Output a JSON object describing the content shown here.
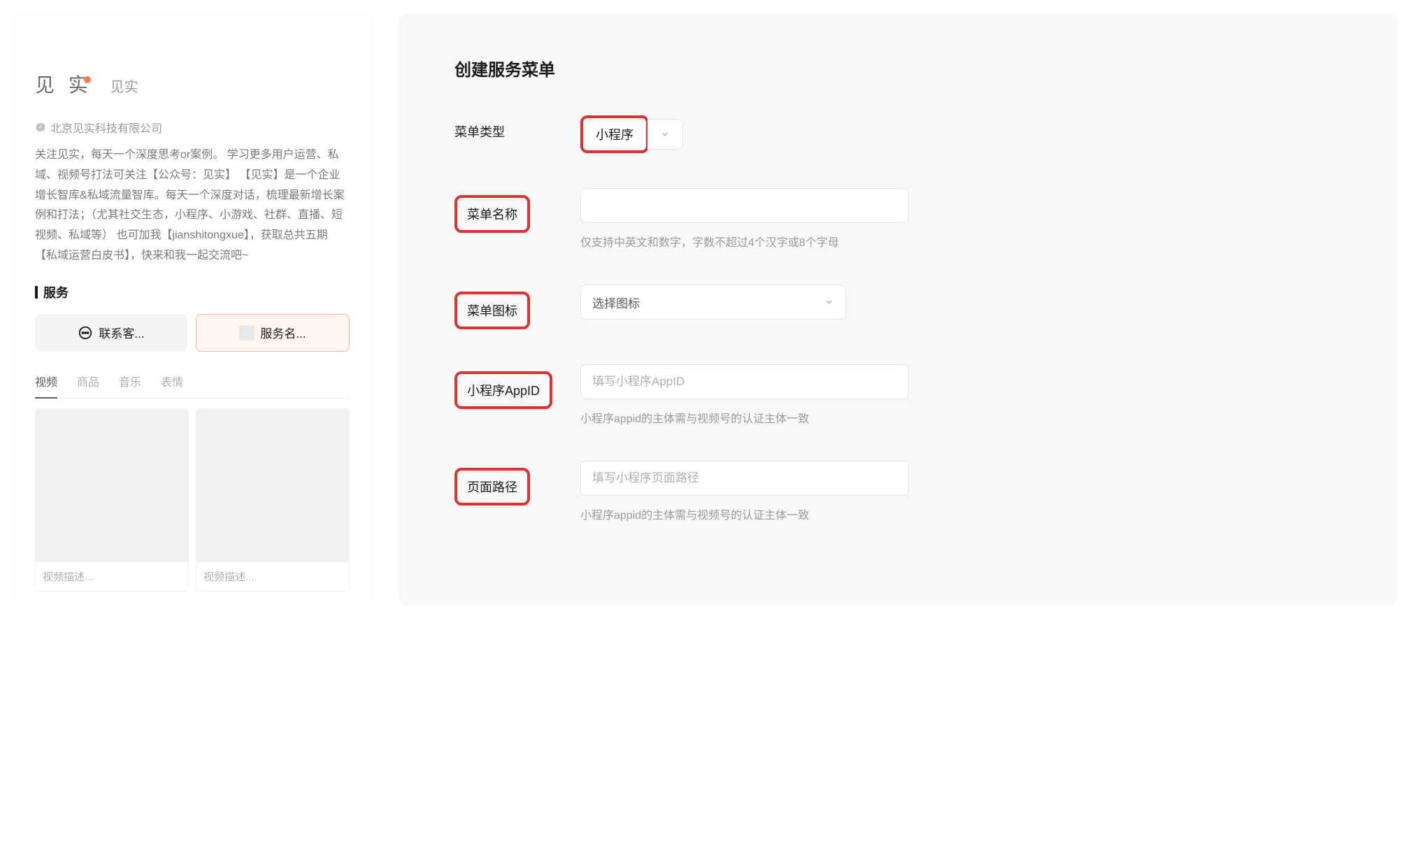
{
  "left": {
    "brandLogo": "见 实",
    "brandName": "见实",
    "company": "北京见实科技有限公司",
    "description": "关注见实，每天一个深度思考or案例。 学习更多用户运营、私域、视频号打法可关注【公众号：见实】 【见实】是一个企业增长智库&私域流量智库。每天一个深度对话，梳理最新增长案例和打法；（尤其社交生态，小程序、小游戏、社群、直播、短视频、私域等） 也可加我【jianshitongxue】，获取总共五期【私域运营白皮书】，快来和我一起交流吧~",
    "serviceTitle": "服务",
    "buttons": {
      "contact": "联系客...",
      "serviceName": "服务名..."
    },
    "tabs": [
      "视频",
      "商品",
      "音乐",
      "表情"
    ],
    "videoDesc": "视频描述..."
  },
  "right": {
    "title": "创建服务菜单",
    "fields": {
      "menuType": {
        "label": "菜单类型",
        "value": "小程序"
      },
      "menuName": {
        "label": "菜单名称",
        "helper": "仅支持中英文和数字，字数不超过4个汉字或8个字母"
      },
      "menuIcon": {
        "label": "菜单图标",
        "placeholder": "选择图标"
      },
      "appId": {
        "label": "小程序AppID",
        "placeholder": "填写小程序AppID",
        "helper": "小程序appid的主体需与视频号的认证主体一致"
      },
      "pagePath": {
        "label": "页面路径",
        "placeholder": "填写小程序页面路径",
        "helper": "小程序appid的主体需与视频号的认证主体一致"
      }
    }
  }
}
